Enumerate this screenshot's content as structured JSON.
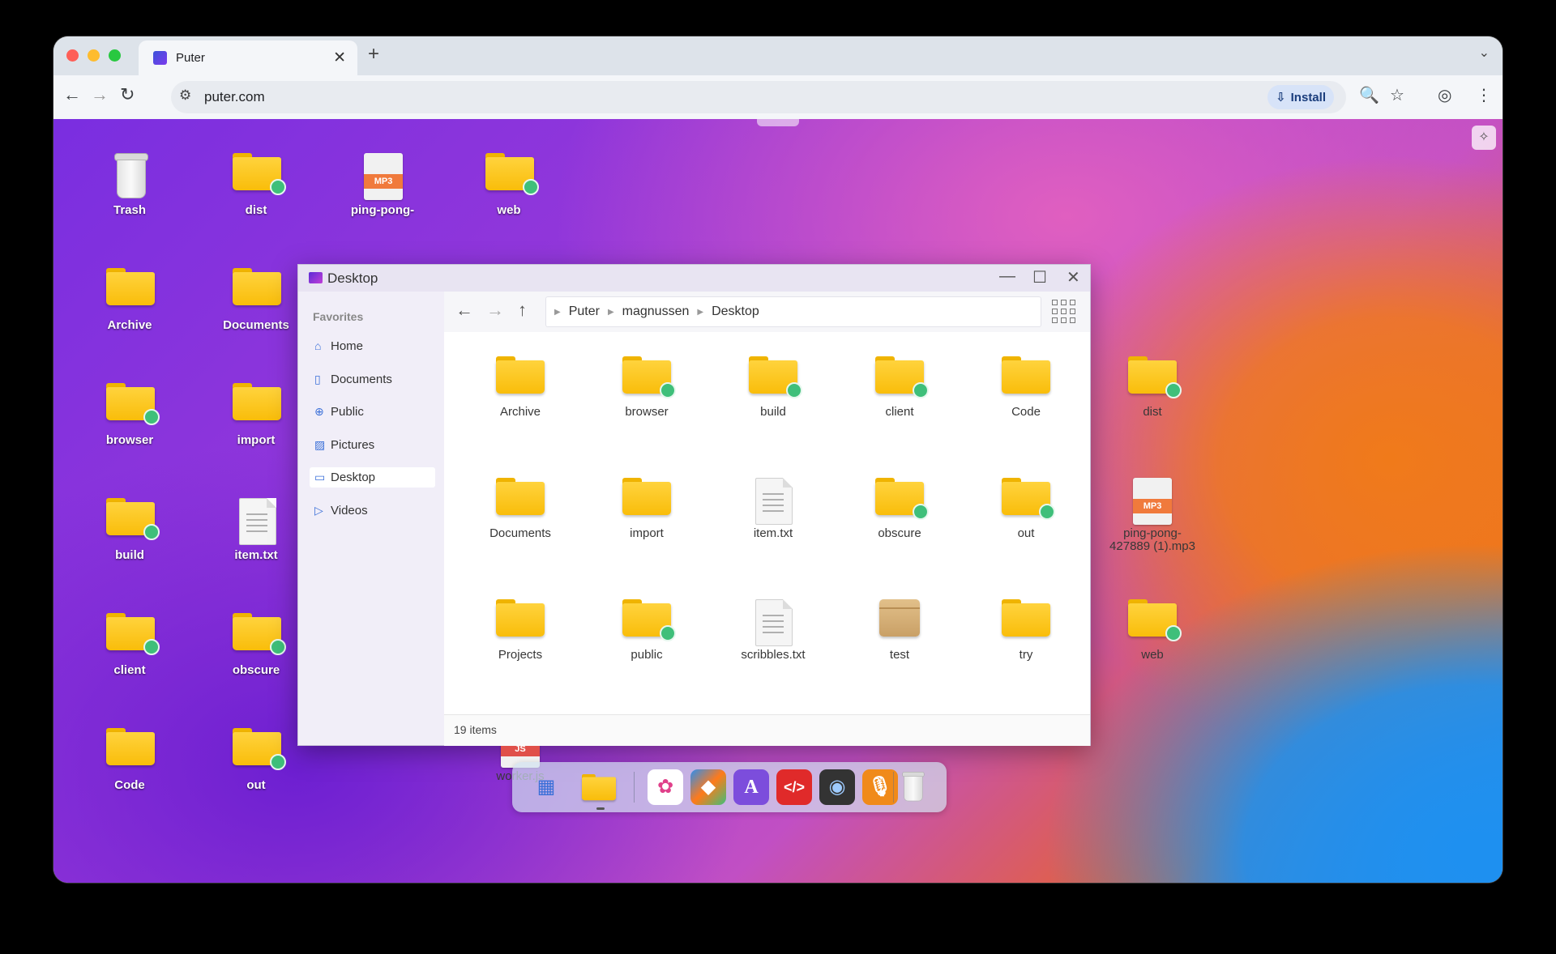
{
  "browser": {
    "tab_title": "Puter",
    "tab_close": "✕",
    "new_tab": "+",
    "tab_menu": "⌄",
    "url": "puter.com",
    "install_label": "Install",
    "icons": {
      "back": "←",
      "forward": "→",
      "reload": "↻",
      "site_info": "⚙",
      "zoom": "🔍",
      "bookmark": "☆",
      "profile": "◎",
      "menu": "⋮",
      "install": "⇩"
    }
  },
  "desktop": {
    "widget_icon": "✧",
    "icons": [
      {
        "label": "Trash",
        "type": "trash"
      },
      {
        "label": "dist",
        "type": "folder",
        "badge": true
      },
      {
        "label": "ping-pong-",
        "type": "mp3"
      },
      {
        "label": "web",
        "type": "folder",
        "badge": true
      },
      {
        "label": "Archive",
        "type": "folder"
      },
      {
        "label": "Documents",
        "type": "folder"
      },
      {
        "label": "browser",
        "type": "folder",
        "badge": true
      },
      {
        "label": "import",
        "type": "folder"
      },
      {
        "label": "build",
        "type": "folder",
        "badge": true
      },
      {
        "label": "item.txt",
        "type": "txt"
      },
      {
        "label": "client",
        "type": "folder",
        "badge": true
      },
      {
        "label": "obscure",
        "type": "folder",
        "badge": true
      },
      {
        "label": "Code",
        "type": "folder"
      },
      {
        "label": "out",
        "type": "folder",
        "badge": true
      }
    ]
  },
  "window": {
    "title": "Desktop",
    "controls": {
      "minimize": "—",
      "maximize": "☐",
      "close": "✕"
    },
    "sidebar": {
      "heading": "Favorites",
      "items": [
        {
          "label": "Home",
          "icon": "⌂"
        },
        {
          "label": "Documents",
          "icon": "▯"
        },
        {
          "label": "Public",
          "icon": "⊕"
        },
        {
          "label": "Pictures",
          "icon": "▨"
        },
        {
          "label": "Desktop",
          "icon": "▭",
          "active": true
        },
        {
          "label": "Videos",
          "icon": "▷"
        }
      ]
    },
    "nav": {
      "back": "←",
      "forward": "→",
      "up": "↑"
    },
    "breadcrumbs": [
      "Puter",
      "magnussen",
      "Desktop"
    ],
    "files": [
      {
        "label": "Archive",
        "type": "folder"
      },
      {
        "label": "browser",
        "type": "folder",
        "badge": true
      },
      {
        "label": "build",
        "type": "folder",
        "badge": true
      },
      {
        "label": "client",
        "type": "folder",
        "badge": true
      },
      {
        "label": "Code",
        "type": "folder"
      },
      {
        "label": "dist",
        "type": "folder",
        "badge": true
      },
      {
        "label": "Documents",
        "type": "folder"
      },
      {
        "label": "import",
        "type": "folder"
      },
      {
        "label": "item.txt",
        "type": "txt"
      },
      {
        "label": "obscure",
        "type": "folder",
        "badge": true
      },
      {
        "label": "out",
        "type": "folder",
        "badge": true
      },
      {
        "label": "ping-pong-427889 (1).mp3",
        "type": "mp3"
      },
      {
        "label": "Projects",
        "type": "folder"
      },
      {
        "label": "public",
        "type": "folder",
        "badge": true
      },
      {
        "label": "scribbles.txt",
        "type": "txt"
      },
      {
        "label": "test",
        "type": "box"
      },
      {
        "label": "try",
        "type": "folder"
      },
      {
        "label": "web",
        "type": "folder",
        "badge": true
      },
      {
        "label": "worker.js",
        "type": "js"
      }
    ],
    "status": "19 items"
  },
  "file_tags": {
    "mp3": "MP3",
    "js": "JS"
  },
  "colors": {
    "folder": "#f9bd0a",
    "badge": "#3fbf7a",
    "mp3_tag": "#f07a3c",
    "js_tag": "#e0504a"
  },
  "dock": {
    "items": [
      {
        "name": "app-launcher",
        "glyph": "▦"
      },
      {
        "name": "files",
        "glyph": ""
      },
      {
        "name": "app-center",
        "glyph": "✿"
      },
      {
        "name": "paint",
        "glyph": "◆"
      },
      {
        "name": "editor",
        "glyph": "A"
      },
      {
        "name": "dev-center",
        "glyph": "</>"
      },
      {
        "name": "camera",
        "glyph": "◉"
      },
      {
        "name": "recorder",
        "glyph": "🎙"
      },
      {
        "name": "trash",
        "glyph": ""
      }
    ]
  }
}
